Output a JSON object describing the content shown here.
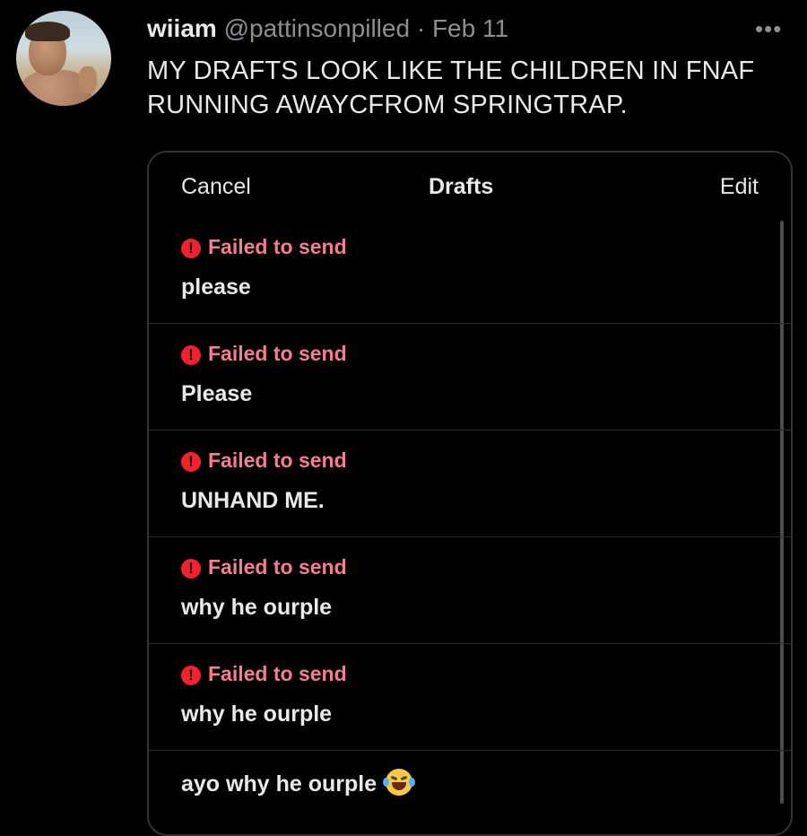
{
  "tweet": {
    "author_name": "wiiam",
    "handle": "@pattinsonpilled",
    "separator": "·",
    "date": "Feb 11",
    "more_icon": "more-icon",
    "text": "MY DRAFTS LOOK LIKE THE CHILDREN IN FNAF RUNNING AWAYCFROM SPRINGTRAP."
  },
  "drafts_panel": {
    "cancel_label": "Cancel",
    "title": "Drafts",
    "edit_label": "Edit",
    "error_color": "#f27f8f",
    "items": [
      {
        "status": "Failed to send",
        "status_icon": "error-icon",
        "text": "please"
      },
      {
        "status": "Failed to send",
        "status_icon": "error-icon",
        "text": "Please"
      },
      {
        "status": "Failed to send",
        "status_icon": "error-icon",
        "text": "UNHAND ME."
      },
      {
        "status": "Failed to send",
        "status_icon": "error-icon",
        "text": "why he ourple"
      },
      {
        "status": "Failed to send",
        "status_icon": "error-icon",
        "text": "why he ourple"
      },
      {
        "status": "",
        "text": "ayo why he ourple",
        "emoji": "laughing-crying-emoji-icon"
      }
    ]
  }
}
